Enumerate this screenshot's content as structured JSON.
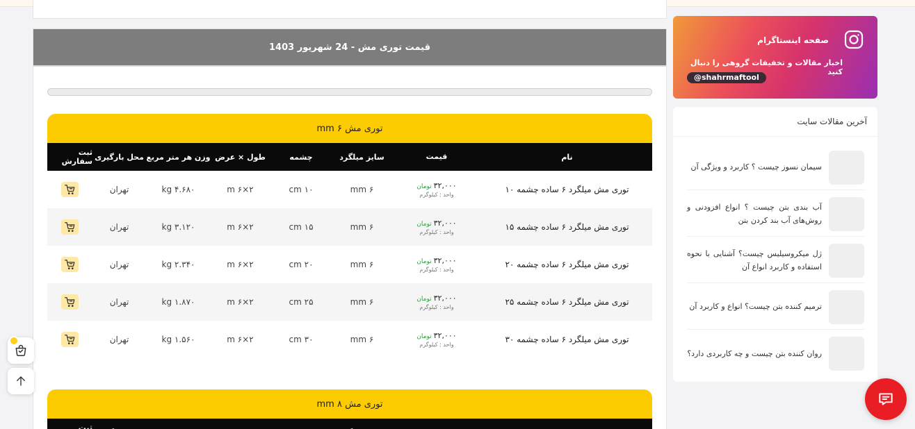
{
  "page": {
    "main_title": "قیمت توری مش - 24 شهریور 1403"
  },
  "columns": {
    "name": "نام",
    "price": "قیمت",
    "size": "سایز میلگرد",
    "eye": "چشمه",
    "dim": "طول × عرض",
    "weight": "وزن هر متر مربع",
    "loc": "محل بارگیری",
    "order": "ثبت سفارش"
  },
  "sections": [
    {
      "title": "توری مش ۶ mm",
      "rows": [
        {
          "name": "توری مش میلگرد ۶ ساده چشمه ۱۰",
          "price": "۳۲,۰۰۰",
          "currency": "تومان",
          "unit": "واحد : کیلوگرم",
          "size": "۶ mm",
          "eye": "۱۰ cm",
          "dim": "۲×۶ m",
          "weight": "۴.۶۸۰ kg",
          "loc": "تهران"
        },
        {
          "name": "توری مش میلگرد ۶ ساده چشمه ۱۵",
          "price": "۳۲,۰۰۰",
          "currency": "تومان",
          "unit": "واحد : کیلوگرم",
          "size": "۶ mm",
          "eye": "۱۵ cm",
          "dim": "۲×۶ m",
          "weight": "۳.۱۲۰ kg",
          "loc": "تهران"
        },
        {
          "name": "توری مش میلگرد ۶ ساده چشمه ۲۰",
          "price": "۳۲,۰۰۰",
          "currency": "تومان",
          "unit": "واحد : کیلوگرم",
          "size": "۶ mm",
          "eye": "۲۰ cm",
          "dim": "۲×۶ m",
          "weight": "۲.۳۴۰ kg",
          "loc": "تهران"
        },
        {
          "name": "توری مش میلگرد ۶ ساده چشمه ۲۵",
          "price": "۳۲,۰۰۰",
          "currency": "تومان",
          "unit": "واحد : کیلوگرم",
          "size": "۶ mm",
          "eye": "۲۵ cm",
          "dim": "۲×۶ m",
          "weight": "۱.۸۷۰ kg",
          "loc": "تهران"
        },
        {
          "name": "توری مش میلگرد ۶ ساده چشمه ۳۰",
          "price": "۳۲,۰۰۰",
          "currency": "تومان",
          "unit": "واحد : کیلوگرم",
          "size": "۶ mm",
          "eye": "۳۰ cm",
          "dim": "۲×۶ m",
          "weight": "۱.۵۶۰ kg",
          "loc": "تهران"
        }
      ]
    },
    {
      "title": "توری مش ۸ mm",
      "rows": []
    }
  ],
  "instagram": {
    "title": "صفحه اینستاگرام",
    "subtitle": "اخبار مقالات و تخفیفات گروهی را دنبال کنید",
    "handle": "@shahrmaftool"
  },
  "articles": {
    "heading": "آخرین مقالات سایت",
    "items": [
      {
        "title": "سیمان نسوز چیست ؟ کاربرد و ویژگی آن"
      },
      {
        "title": "آب بندی بتن چیست ؟ انواع افزودنی و روش‌های آب بند کردن بتن"
      },
      {
        "title": "ژل میکروسیلیس چیست؟ آشنایی با نحوه استفاده و کاربرد انواع آن"
      },
      {
        "title": "ترمیم کننده بتن چیست؟ انواع و کاربرد آن"
      },
      {
        "title": "روان کننده بتن چیست و چه کاربردی دارد؟"
      }
    ]
  },
  "icons": {
    "cart": "cart-icon",
    "instagram": "instagram-icon",
    "basket": "basket-icon",
    "scroll_top": "arrow-up-icon",
    "chat": "chat-icon"
  },
  "colors": {
    "section_title_bg": "#fccb00",
    "header_bg": "#7d7d7d",
    "chat_red": "#e91e25",
    "price_currency": "#2f9e44"
  }
}
